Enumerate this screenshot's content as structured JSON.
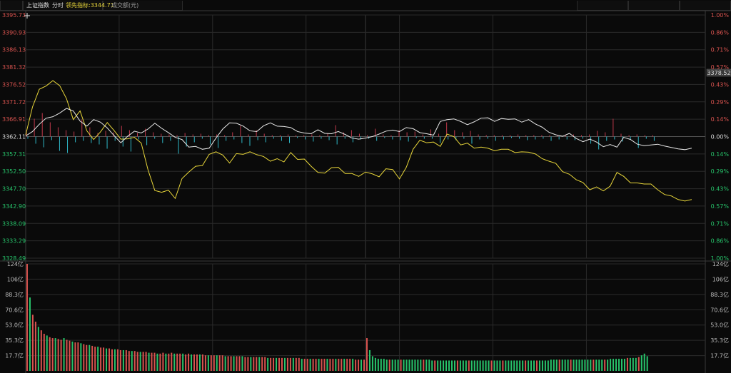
{
  "header": {
    "index_name": "上证指数",
    "tab_timeshare": "分时",
    "leading_indicator": "领先指标:3344.71",
    "turnover_label": "成交额(元)"
  },
  "price_tag": "3378.52",
  "colors": {
    "up": "#d9534f",
    "down": "#27c46b",
    "flat": "#dddddd",
    "price_line": "#e8e8e8",
    "leading_line": "#e8d63a",
    "up_bar": "#c0394b",
    "down_bar": "#2fb8c8",
    "grid": "#2a2a2a",
    "grid_mid": "#3a3a3a"
  },
  "chart_data": [
    {
      "type": "line",
      "title": "上证指数",
      "base": 3362.11,
      "ylim": [
        3328.49,
        3395.73
      ],
      "y_ticks_left": [
        "3395.73",
        "3390.93",
        "3386.13",
        "3381.32",
        "3376.52",
        "3371.72",
        "3366.91",
        "3362.11",
        "3357.31",
        "3352.50",
        "3347.70",
        "3342.90",
        "3338.09",
        "3333.29",
        "3328.49"
      ],
      "y_ticks_right": [
        "1.00%",
        "0.86%",
        "0.71%",
        "0.57%",
        "0.43%",
        "0.29%",
        "0.14%",
        "0.00%",
        "0.14%",
        "0.29%",
        "0.43%",
        "0.57%",
        "0.71%",
        "0.86%",
        "1.00%"
      ],
      "series": [
        {
          "name": "上证指数",
          "key": "price",
          "values": [
            [
              0,
              3362.3
            ],
            [
              4,
              3363.5
            ],
            [
              8,
              3365.5
            ],
            [
              12,
              3367.2
            ],
            [
              16,
              3367.6
            ],
            [
              20,
              3368.6
            ],
            [
              24,
              3369.9
            ],
            [
              28,
              3369.2
            ],
            [
              32,
              3366.4
            ],
            [
              36,
              3365.0
            ],
            [
              40,
              3366.8
            ],
            [
              44,
              3366.1
            ],
            [
              48,
              3364.5
            ],
            [
              52,
              3362.4
            ],
            [
              56,
              3360.4
            ],
            [
              60,
              3362.2
            ],
            [
              64,
              3363.6
            ],
            [
              68,
              3363.1
            ],
            [
              72,
              3364.2
            ],
            [
              76,
              3365.8
            ],
            [
              80,
              3364.4
            ],
            [
              84,
              3363.2
            ],
            [
              88,
              3361.9
            ],
            [
              92,
              3361.3
            ],
            [
              96,
              3359.2
            ],
            [
              100,
              3359.4
            ],
            [
              104,
              3358.6
            ],
            [
              108,
              3358.9
            ],
            [
              112,
              3361.7
            ],
            [
              116,
              3364.2
            ],
            [
              120,
              3365.9
            ],
            [
              124,
              3365.8
            ],
            [
              128,
              3365.0
            ],
            [
              132,
              3363.7
            ],
            [
              136,
              3363.5
            ],
            [
              140,
              3365.1
            ],
            [
              144,
              3365.9
            ],
            [
              148,
              3365.0
            ],
            [
              152,
              3364.9
            ],
            [
              156,
              3364.6
            ],
            [
              160,
              3363.5
            ],
            [
              164,
              3363.1
            ],
            [
              168,
              3362.9
            ],
            [
              172,
              3364.0
            ],
            [
              176,
              3363.0
            ],
            [
              180,
              3362.9
            ],
            [
              184,
              3363.5
            ],
            [
              188,
              3362.7
            ],
            [
              192,
              3361.7
            ],
            [
              196,
              3361.4
            ],
            [
              200,
              3361.7
            ],
            [
              204,
              3362.1
            ],
            [
              208,
              3362.8
            ],
            [
              212,
              3363.6
            ],
            [
              216,
              3363.9
            ],
            [
              220,
              3363.5
            ],
            [
              224,
              3364.6
            ],
            [
              228,
              3364.3
            ],
            [
              232,
              3363.2
            ],
            [
              236,
              3362.9
            ],
            [
              240,
              3362.5
            ],
            [
              244,
              3366.3
            ],
            [
              248,
              3366.8
            ],
            [
              252,
              3367.0
            ],
            [
              256,
              3366.3
            ],
            [
              260,
              3365.4
            ],
            [
              264,
              3366.2
            ],
            [
              268,
              3367.2
            ],
            [
              272,
              3367.3
            ],
            [
              276,
              3366.3
            ],
            [
              280,
              3367.1
            ],
            [
              284,
              3366.9
            ],
            [
              288,
              3367.0
            ],
            [
              292,
              3366.1
            ],
            [
              296,
              3366.8
            ],
            [
              300,
              3365.6
            ],
            [
              304,
              3364.7
            ],
            [
              308,
              3363.3
            ],
            [
              312,
              3362.6
            ],
            [
              316,
              3362.2
            ],
            [
              320,
              3363.0
            ],
            [
              324,
              3361.6
            ],
            [
              328,
              3360.7
            ],
            [
              332,
              3361.4
            ],
            [
              336,
              3360.6
            ],
            [
              340,
              3359.3
            ],
            [
              344,
              3359.9
            ],
            [
              348,
              3359.2
            ],
            [
              352,
              3361.9
            ],
            [
              356,
              3361.3
            ],
            [
              360,
              3360.0
            ],
            [
              364,
              3359.6
            ],
            [
              368,
              3359.8
            ],
            [
              372,
              3360.0
            ],
            [
              376,
              3359.5
            ],
            [
              380,
              3359.1
            ],
            [
              384,
              3358.7
            ],
            [
              388,
              3358.5
            ],
            [
              392,
              3358.9
            ]
          ]
        },
        {
          "name": "领先指标",
          "key": "leading",
          "values": [
            [
              0,
              3362.6
            ],
            [
              4,
              3370.3
            ],
            [
              8,
              3375.2
            ],
            [
              12,
              3376.1
            ],
            [
              16,
              3377.6
            ],
            [
              20,
              3376.2
            ],
            [
              24,
              3372.6
            ],
            [
              28,
              3366.8
            ],
            [
              32,
              3369.2
            ],
            [
              36,
              3363.7
            ],
            [
              40,
              3361.3
            ],
            [
              44,
              3363.4
            ],
            [
              48,
              3366.0
            ],
            [
              52,
              3363.8
            ],
            [
              56,
              3361.4
            ],
            [
              60,
              3361.5
            ],
            [
              64,
              3361.9
            ],
            [
              68,
              3360.3
            ],
            [
              72,
              3352.9
            ],
            [
              76,
              3347.2
            ],
            [
              80,
              3346.7
            ],
            [
              84,
              3347.3
            ],
            [
              88,
              3345.0
            ],
            [
              92,
              3350.5
            ],
            [
              96,
              3352.3
            ],
            [
              100,
              3353.9
            ],
            [
              104,
              3354.1
            ],
            [
              108,
              3357.2
            ],
            [
              112,
              3357.9
            ],
            [
              116,
              3357.0
            ],
            [
              120,
              3354.8
            ],
            [
              124,
              3357.4
            ],
            [
              128,
              3357.2
            ],
            [
              132,
              3357.9
            ],
            [
              136,
              3357.1
            ],
            [
              140,
              3356.6
            ],
            [
              144,
              3355.3
            ],
            [
              148,
              3356.0
            ],
            [
              152,
              3355.1
            ],
            [
              156,
              3357.7
            ],
            [
              160,
              3355.8
            ],
            [
              164,
              3355.9
            ],
            [
              168,
              3353.9
            ],
            [
              172,
              3352.2
            ],
            [
              176,
              3352.0
            ],
            [
              180,
              3353.5
            ],
            [
              184,
              3353.6
            ],
            [
              188,
              3351.9
            ],
            [
              192,
              3351.9
            ],
            [
              196,
              3351.1
            ],
            [
              200,
              3352.3
            ],
            [
              204,
              3351.8
            ],
            [
              208,
              3351.0
            ],
            [
              212,
              3353.2
            ],
            [
              216,
              3353.0
            ],
            [
              220,
              3350.4
            ],
            [
              224,
              3353.6
            ],
            [
              228,
              3358.6
            ],
            [
              232,
              3361.1
            ],
            [
              236,
              3360.4
            ],
            [
              240,
              3360.6
            ],
            [
              244,
              3359.4
            ],
            [
              248,
              3362.8
            ],
            [
              252,
              3362.1
            ],
            [
              256,
              3359.8
            ],
            [
              260,
              3360.3
            ],
            [
              264,
              3358.9
            ],
            [
              268,
              3359.2
            ],
            [
              272,
              3358.9
            ],
            [
              276,
              3358.2
            ],
            [
              280,
              3358.6
            ],
            [
              284,
              3358.6
            ],
            [
              288,
              3357.7
            ],
            [
              292,
              3357.9
            ],
            [
              296,
              3357.8
            ],
            [
              300,
              3357.3
            ],
            [
              304,
              3356.0
            ],
            [
              308,
              3355.3
            ],
            [
              312,
              3354.7
            ],
            [
              316,
              3352.4
            ],
            [
              320,
              3351.7
            ],
            [
              324,
              3350.2
            ],
            [
              328,
              3349.4
            ],
            [
              332,
              3347.4
            ],
            [
              336,
              3348.2
            ],
            [
              340,
              3347.1
            ],
            [
              344,
              3348.4
            ],
            [
              348,
              3352.2
            ],
            [
              352,
              3351.1
            ],
            [
              356,
              3349.3
            ],
            [
              360,
              3349.3
            ],
            [
              364,
              3349.0
            ],
            [
              368,
              3349.0
            ],
            [
              372,
              3347.4
            ],
            [
              376,
              3346.1
            ],
            [
              380,
              3345.7
            ],
            [
              384,
              3344.7
            ],
            [
              388,
              3344.3
            ],
            [
              392,
              3344.7
            ]
          ]
        }
      ]
    },
    {
      "type": "bar",
      "title": "成交额(元)",
      "ylim": [
        0,
        124
      ],
      "y_ticks": [
        "124亿",
        "106亿",
        "88.3亿",
        "70.6亿",
        "53.0亿",
        "35.3亿",
        "17.7亿"
      ],
      "unit": "亿",
      "values": [
        124,
        85,
        65,
        57,
        51,
        47,
        43,
        41,
        39,
        38,
        38,
        37,
        36,
        38,
        36,
        35,
        34,
        33,
        33,
        32,
        31,
        30,
        30,
        29,
        28,
        28,
        27,
        27,
        26,
        26,
        25,
        25,
        25,
        24,
        24,
        24,
        23,
        23,
        23,
        22,
        22,
        22,
        22,
        21,
        21,
        21,
        20,
        20,
        21,
        20,
        20,
        21,
        20,
        20,
        20,
        20,
        19,
        20,
        19,
        19,
        19,
        19,
        19,
        18,
        18,
        18,
        18,
        18,
        18,
        18,
        17,
        17,
        17,
        17,
        17,
        17,
        17,
        16,
        16,
        16,
        16,
        16,
        16,
        16,
        16,
        15,
        15,
        15,
        15,
        15,
        15,
        15,
        15,
        15,
        15,
        15,
        15,
        14,
        14,
        14,
        14,
        14,
        14,
        14,
        14,
        14,
        14,
        14,
        14,
        14,
        14,
        14,
        14,
        14,
        14,
        14,
        13,
        13,
        13,
        13,
        38,
        24,
        17,
        15,
        14,
        14,
        14,
        13,
        13,
        13,
        13,
        13,
        13,
        13,
        13,
        13,
        13,
        13,
        13,
        13,
        13,
        13,
        13,
        12,
        12,
        12,
        12,
        12,
        12,
        12,
        12,
        12,
        12,
        12,
        12,
        12,
        12,
        12,
        12,
        12,
        12,
        12,
        12,
        12,
        12,
        12,
        12,
        12,
        12,
        12,
        12,
        12,
        12,
        12,
        12,
        12,
        12,
        12,
        12,
        12,
        12,
        12,
        12,
        12,
        12,
        13,
        13,
        13,
        13,
        13,
        13,
        13,
        13,
        13,
        13,
        13,
        13,
        13,
        13,
        13,
        13,
        13,
        13,
        13,
        13,
        13,
        14,
        14,
        14,
        14,
        14,
        14,
        15,
        15,
        15,
        15,
        16,
        18,
        20,
        17
      ]
    }
  ],
  "sentiment": {
    "up_heights": [
      9,
      25,
      33,
      20,
      13,
      9,
      7,
      24,
      13,
      5,
      8,
      6,
      15,
      9,
      5,
      11,
      6,
      4,
      3,
      2,
      5,
      3,
      4,
      2,
      3,
      2,
      6,
      15,
      3,
      9,
      4,
      2,
      2,
      3,
      2,
      2,
      3,
      2,
      4,
      16,
      6,
      9,
      4,
      2,
      11,
      3,
      2,
      9,
      6,
      7,
      3,
      10,
      4,
      20,
      9,
      6,
      8,
      3,
      2,
      2,
      2,
      2,
      3,
      2,
      2,
      2,
      2,
      2,
      2,
      3,
      2,
      3,
      8,
      6,
      25,
      4,
      2,
      3,
      2,
      2
    ],
    "down_heights": [
      3,
      10,
      15,
      5,
      20,
      23,
      8,
      6,
      9,
      11,
      17,
      6,
      14,
      21,
      4,
      12,
      3,
      9,
      6,
      24,
      14,
      8,
      3,
      11,
      16,
      6,
      4,
      9,
      13,
      5,
      8,
      3,
      6,
      9,
      2,
      4,
      7,
      3,
      5,
      11,
      3,
      8,
      4,
      3,
      6,
      2,
      4,
      5,
      7,
      2,
      3,
      3,
      9,
      4,
      5,
      3,
      10,
      4,
      3,
      6,
      4,
      2,
      3,
      5,
      4,
      3,
      6,
      4,
      4,
      5,
      3,
      10,
      18,
      6,
      4,
      7,
      4,
      16,
      3,
      6
    ]
  }
}
